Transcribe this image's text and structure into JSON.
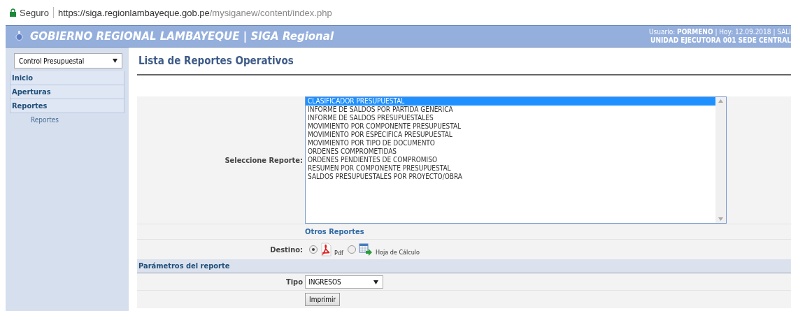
{
  "address_bar": {
    "security": "Seguro",
    "url_host": "https://siga.regionlambayeque.gob.pe",
    "url_path": "/mysiganew/content/index.php"
  },
  "header": {
    "title": "GOBIERNO REGIONAL LAMBAYEQUE | SIGA Regional",
    "user_line": "Usuario: **PORMENO** | Hoy: 12.09.2018 | SALI",
    "unit": "UNIDAD EJECUTORA 001 SEDE CENTRAL"
  },
  "sidebar": {
    "module_select": "Control Presupuestal",
    "items": [
      {
        "label": "Inicio"
      },
      {
        "label": "Aperturas"
      },
      {
        "label": "Reportes",
        "children": [
          {
            "label": "Reportes"
          }
        ]
      }
    ]
  },
  "page_title": "Lista de Reportes Operativos",
  "form": {
    "report_label": "Seleccione Reporte:",
    "reports": [
      {
        "label": "CLASIFICADOR PRESUPUESTAL",
        "selected": true
      },
      {
        "label": "INFORME DE SALDOS POR PARTIDA GENERICA",
        "selected": false
      },
      {
        "label": "INFORME DE SALDOS PRESUPUESTALES",
        "selected": false
      },
      {
        "label": "MOVIMIENTO POR COMPONENTE PRESUPUESTAL",
        "selected": false
      },
      {
        "label": "MOVIMIENTO POR ESPECIFICA PRESUPUESTAL",
        "selected": false
      },
      {
        "label": "MOVIMIENTO POR TIPO DE DOCUMENTO",
        "selected": false
      },
      {
        "label": "ORDENES COMPROMETIDAS",
        "selected": false
      },
      {
        "label": "ORDENES PENDIENTES DE COMPROMISO",
        "selected": false
      },
      {
        "label": "RESUMEN POR COMPONENTE PRESUPUESTAL",
        "selected": false
      },
      {
        "label": "SALDOS PRESUPUESTALES POR PROYECTO/OBRA",
        "selected": false
      }
    ],
    "other_reports_link": "Otros Reportes",
    "destination_label": "Destino:",
    "destinations": [
      {
        "kind": "pdf",
        "label": "Pdf",
        "selected": true
      },
      {
        "kind": "spreadsheet",
        "label": "Hoja de Cálculo",
        "selected": false
      }
    ],
    "params_header": "Parámetros del reporte",
    "tipo_label": "Tipo",
    "tipo_value": "INGRESOS",
    "print_button": "Imprimir"
  }
}
